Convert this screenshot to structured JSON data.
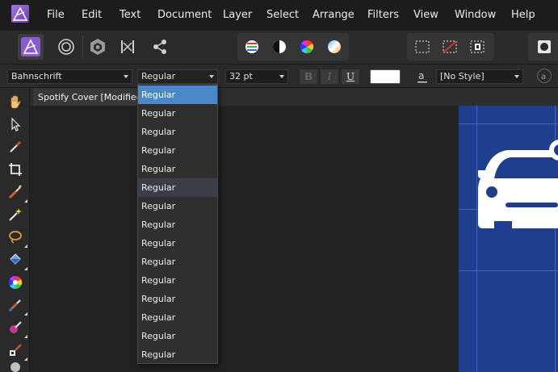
{
  "menu": {
    "items": [
      "File",
      "Edit",
      "Text",
      "Document",
      "Layer",
      "Select",
      "Arrange",
      "Filters",
      "View",
      "Window",
      "Help"
    ]
  },
  "context_toolbar": {
    "font_family": "Bahnschrift",
    "font_style": "Regular",
    "font_size": "32 pt",
    "bold_label": "B",
    "italic_label": "I",
    "underline_label": "U",
    "paragraph_style": "[No Style]",
    "text_fill_color": "#ffffff"
  },
  "document_tab": {
    "title": "Spotify Cover [Modified]"
  },
  "font_style_dropdown": {
    "options": [
      "Regular",
      "Regular",
      "Regular",
      "Regular",
      "Regular",
      "Regular",
      "Regular",
      "Regular",
      "Regular",
      "Regular",
      "Regular",
      "Regular",
      "Regular",
      "Regular",
      "Regular"
    ],
    "selected_index": 0,
    "hover_index": 5
  },
  "colors": {
    "accent": "#4a88c9",
    "artboard": "#1f3f8e",
    "persona_logo": "#8a5ad0"
  }
}
